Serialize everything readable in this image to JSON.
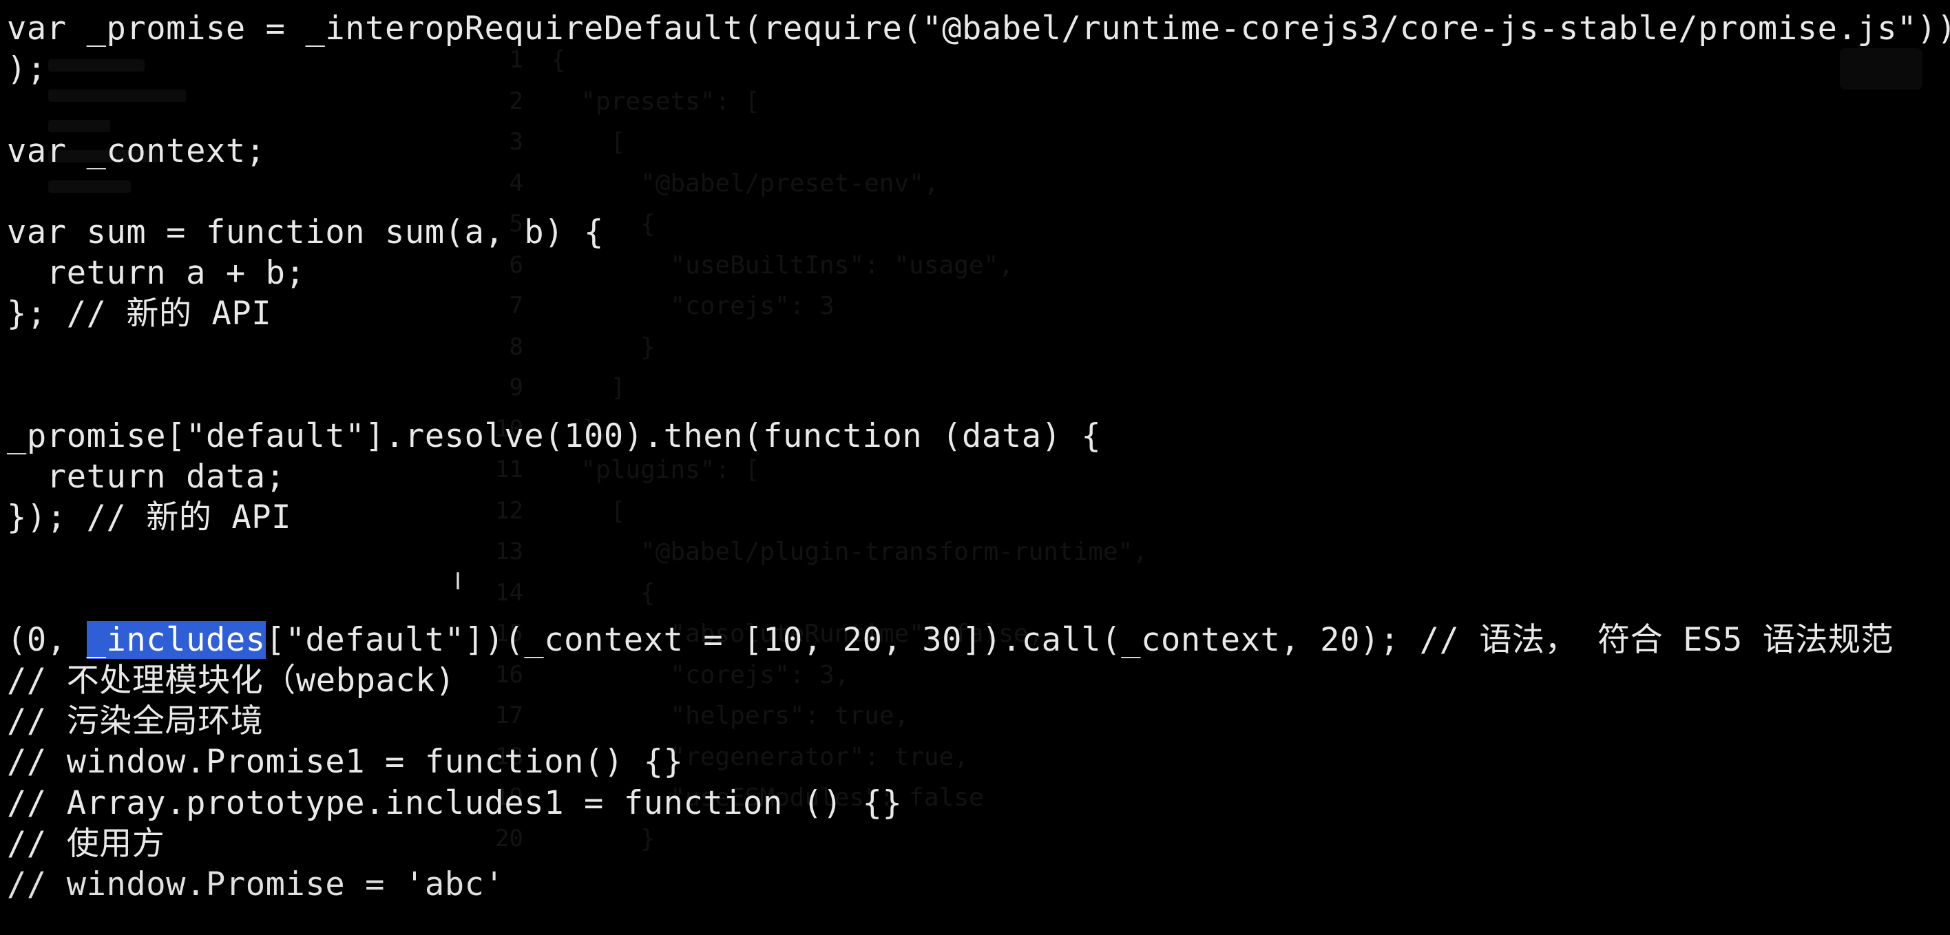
{
  "background_editor": {
    "gutter": [
      "1",
      "2",
      "3",
      "4",
      "5",
      "6",
      "7",
      "8",
      "9",
      "10",
      "11",
      "12",
      "13",
      "14",
      "15",
      "16",
      "17",
      "18",
      "19",
      "20"
    ],
    "lines": [
      "{",
      "  \"presets\": [",
      "    [",
      "      \"@babel/preset-env\",",
      "      {",
      "        \"useBuiltIns\": \"usage\",",
      "        \"corejs\": 3",
      "      }",
      "    ]",
      "  ],",
      "  \"plugins\": [",
      "    [",
      "      \"@babel/plugin-transform-runtime\",",
      "      {",
      "        \"absoluteRuntime\": false,",
      "        \"corejs\": 3,",
      "        \"helpers\": true,",
      "        \"regenerator\": true,",
      "        \"useESModules\": false",
      "      }"
    ]
  },
  "terminal": {
    "lines": [
      "var _promise = _interopRequireDefault(require(\"@babel/runtime-corejs3/core-js-stable/promise.js\"));",
      ");",
      "",
      "var _context;",
      "",
      "var sum = function sum(a, b) {",
      "  return a + b;",
      "}; // 新的 API",
      "",
      "",
      "_promise[\"default\"].resolve(100).then(function (data) {",
      "  return data;",
      "}); // 新的 API",
      "",
      "",
      "",
      "// 不处理模块化（webpack)",
      "// 污染全局环境",
      "// window.Promise1 = function() {}",
      "// Array.prototype.includes1 = function () {}",
      "// 使用方"
    ],
    "includes_line": {
      "prefix": "(0, ",
      "selected": "_includes",
      "suffix": "[\"default\"])(_context = [10, 20, 30]).call(_context, 20); // 语法， 符合 ES5 语法规范"
    },
    "last_line_partial": "// window.Promise = 'abc'",
    "text_cursor_glyph": "I"
  },
  "colors": {
    "background": "#000000",
    "text": "#e9e9e9",
    "selection": "#2e5fd6"
  }
}
